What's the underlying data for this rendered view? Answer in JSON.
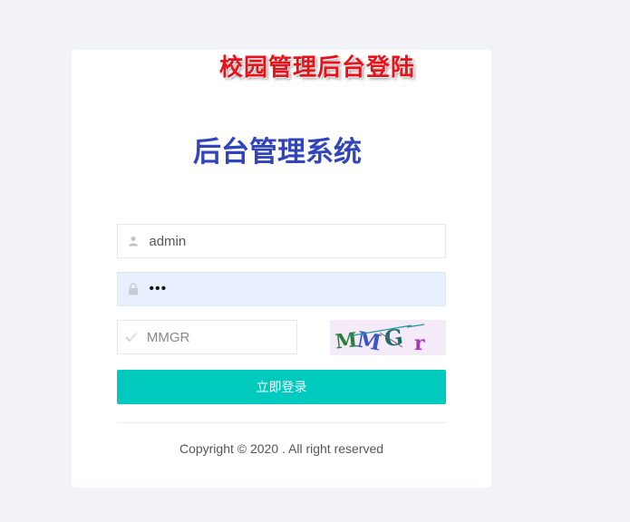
{
  "banner": {
    "text": "校园管理后台登陆",
    "color": "#e8121b"
  },
  "login": {
    "title": "后台管理系统",
    "title_color": "#3144bb",
    "username": {
      "value": "admin",
      "icon": "user-icon"
    },
    "password": {
      "value": "•••",
      "icon": "lock-icon"
    },
    "captcha_input": {
      "placeholder": "MMGR",
      "icon": "check-icon"
    },
    "captcha_image": {
      "text": "MMGr",
      "icon": "captcha-image"
    },
    "submit_label": "立即登录",
    "accent": "#00c9bd"
  },
  "footer": {
    "copyright": "Copyright © 2020 . All right reserved"
  }
}
